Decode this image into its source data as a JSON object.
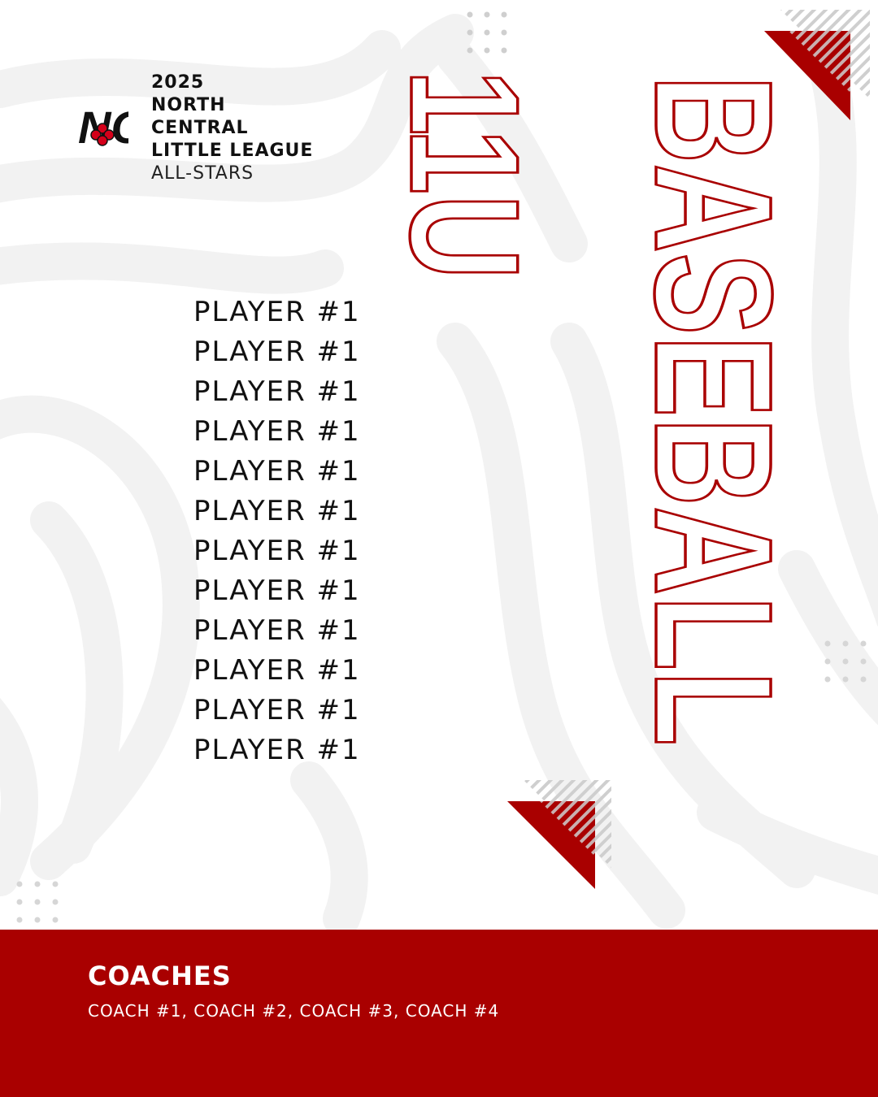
{
  "header": {
    "year": "2025",
    "line1": "NORTH",
    "line2": "CENTRAL",
    "line3": "LITTLE LEAGUE",
    "subtitle": "ALL-STARS",
    "logo_text": "NC"
  },
  "division": "11U",
  "sport": "BASEBALL",
  "players": [
    "PLAYER #1",
    "PLAYER #1",
    "PLAYER #1",
    "PLAYER #1",
    "PLAYER #1",
    "PLAYER #1",
    "PLAYER #1",
    "PLAYER #1",
    "PLAYER #1",
    "PLAYER #1",
    "PLAYER #1",
    "PLAYER #1"
  ],
  "coaches": {
    "title": "COACHES",
    "list": "COACH #1, COACH #2, COACH #3, COACH #4"
  },
  "colors": {
    "accent": "#a90000",
    "swirl": "#f2f2f2"
  }
}
